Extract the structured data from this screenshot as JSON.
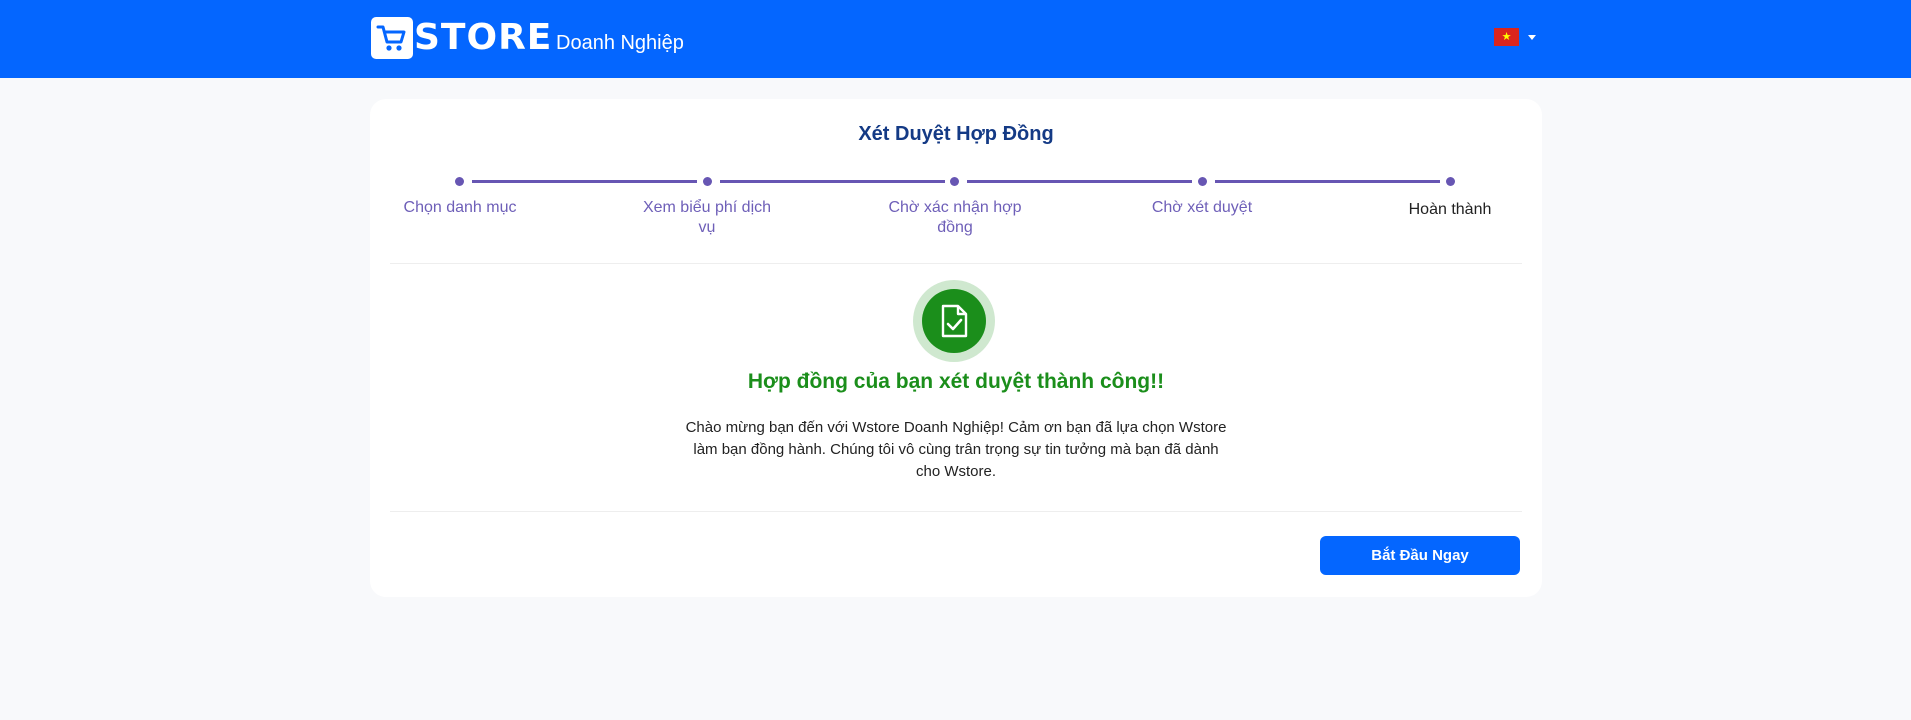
{
  "header": {
    "logo_text": "STORE",
    "subtitle": "Doanh Nghiệp",
    "language_flag": "vietnam-flag"
  },
  "card": {
    "title": "Xét Duyệt Hợp Đồng",
    "steps": [
      {
        "label": "Chọn danh mục"
      },
      {
        "label": "Xem biểu phí dịch vụ"
      },
      {
        "label": "Chờ xác nhận hợp đồng"
      },
      {
        "label": "Chờ xét duyệt"
      },
      {
        "label": "Hoàn thành"
      }
    ],
    "success_title": "Hợp đồng của bạn xét duyệt thành công!!",
    "message": "Chào mừng bạn đến với Wstore Doanh Nghiệp! Cảm ơn bạn đã lựa chọn Wstore làm bạn đồng hành. Chúng tôi vô cùng trân trọng sự tin tưởng mà bạn đã dành cho Wstore.",
    "start_button": "Bắt Đầu Ngay"
  },
  "colors": {
    "header_bg": "#0466ff",
    "step_accent": "#6756b3",
    "success_green": "#1b8e1b",
    "title_blue": "#143a85"
  }
}
